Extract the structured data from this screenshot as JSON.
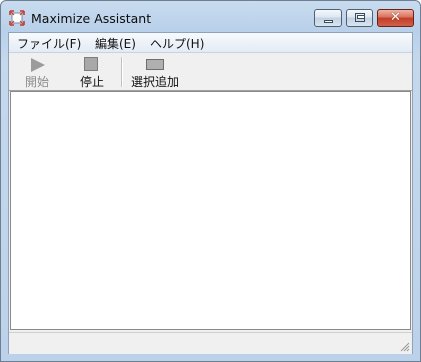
{
  "window": {
    "title": "Maximize Assistant"
  },
  "caption": {
    "minimize_icon": "minimize-icon",
    "maximize_icon": "maximize-icon",
    "close_glyph": "✕"
  },
  "menu": {
    "items": [
      "ファイル(F)",
      "編集(E)",
      "ヘルプ(H)"
    ]
  },
  "toolbar": {
    "start_label": "開始",
    "stop_label": "停止",
    "add_label": "選択追加",
    "start_enabled": false
  },
  "colors": {
    "titlebar": "#c9dcef",
    "close_button": "#c23d24",
    "client": "#f0f0f0"
  }
}
